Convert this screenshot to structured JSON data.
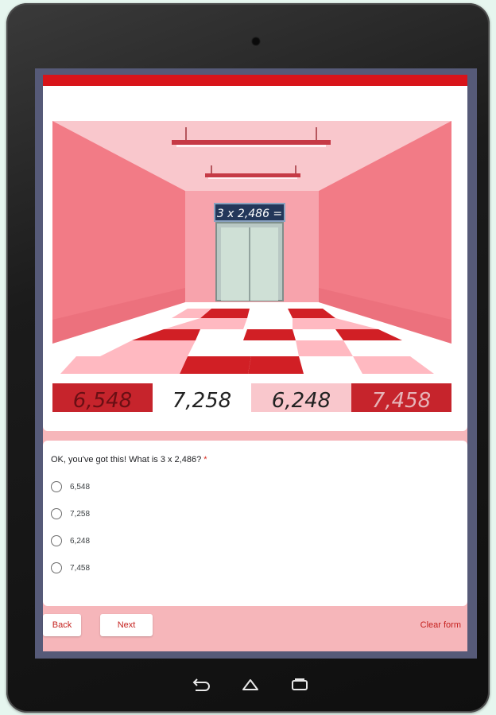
{
  "image": {
    "equation_sign": "3 x 2,486 =",
    "floor_numbers": [
      "6,548",
      "7,258",
      "6,248",
      "7,458"
    ]
  },
  "question": {
    "text": "OK, you've got this! What is 3 x 2,486?",
    "required_mark": "*",
    "options": [
      "6,548",
      "7,258",
      "6,248",
      "7,458"
    ]
  },
  "buttons": {
    "back": "Back",
    "next": "Next",
    "clear": "Clear form"
  },
  "colors": {
    "accent": "#d8141a",
    "form_background": "#f6b6ba",
    "link_text": "#c5221f"
  },
  "icons": [
    "back-nav-icon",
    "home-nav-icon",
    "recents-nav-icon"
  ]
}
